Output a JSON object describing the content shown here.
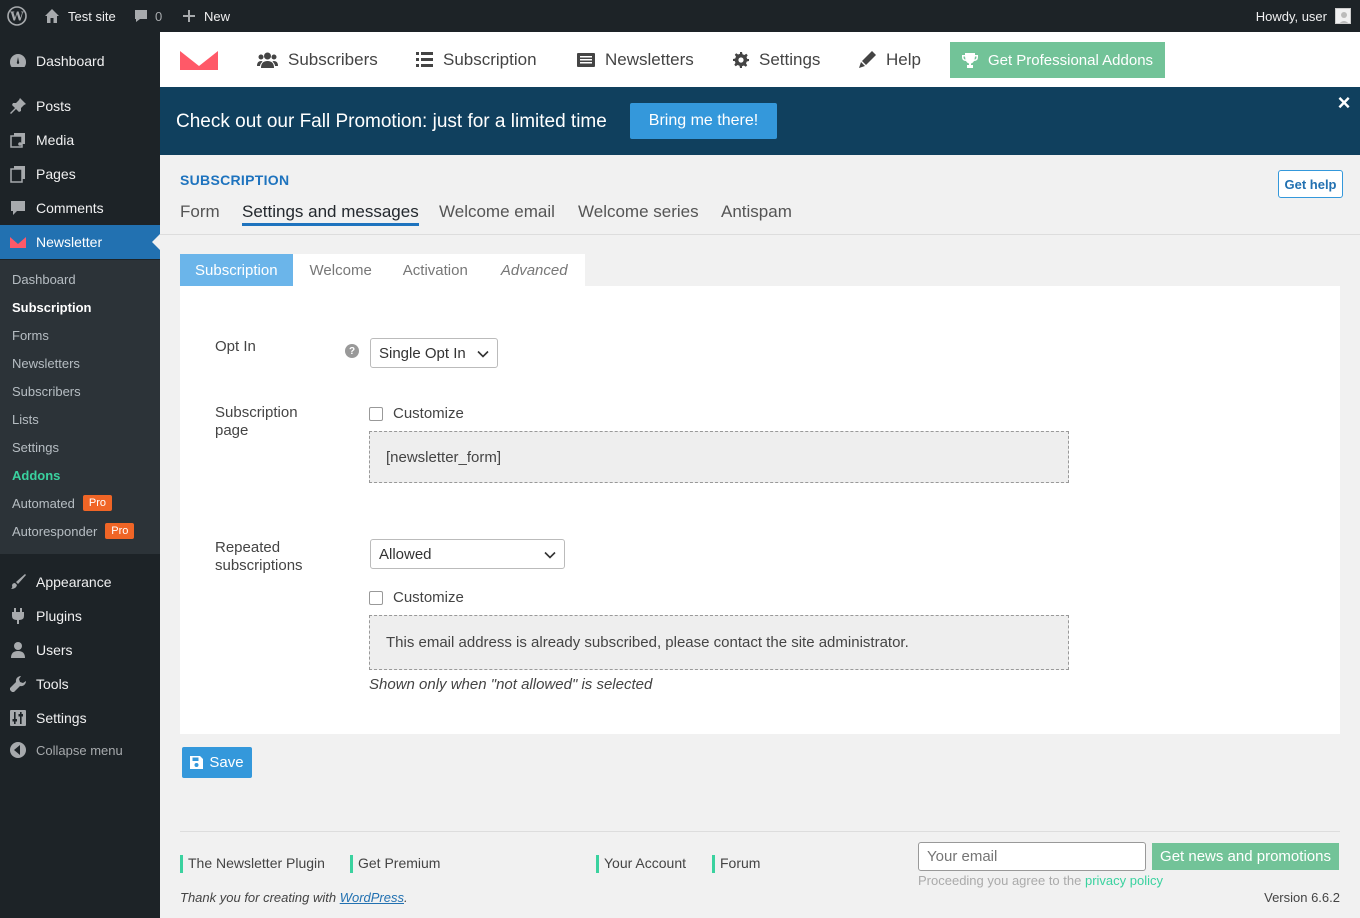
{
  "admin_bar": {
    "site_name": "Test site",
    "comments_count": "0",
    "new_label": "New",
    "howdy": "Howdy, user"
  },
  "sidebar": {
    "items": [
      {
        "label": "Dashboard",
        "icon": "dashboard-icon"
      },
      {
        "label": "Posts",
        "icon": "pin-icon"
      },
      {
        "label": "Media",
        "icon": "media-icon"
      },
      {
        "label": "Pages",
        "icon": "pages-icon"
      },
      {
        "label": "Comments",
        "icon": "comment-icon"
      },
      {
        "label": "Newsletter",
        "icon": "newsletter-icon"
      },
      {
        "label": "Appearance",
        "icon": "brush-icon"
      },
      {
        "label": "Plugins",
        "icon": "plug-icon"
      },
      {
        "label": "Users",
        "icon": "user-icon"
      },
      {
        "label": "Tools",
        "icon": "wrench-icon"
      },
      {
        "label": "Settings",
        "icon": "sliders-icon"
      }
    ],
    "submenu": [
      {
        "label": "Dashboard"
      },
      {
        "label": "Subscription"
      },
      {
        "label": "Forms"
      },
      {
        "label": "Newsletters"
      },
      {
        "label": "Subscribers"
      },
      {
        "label": "Lists"
      },
      {
        "label": "Settings"
      },
      {
        "label": "Addons"
      },
      {
        "label": "Automated",
        "badge": "Pro"
      },
      {
        "label": "Autoresponder",
        "badge": "Pro"
      }
    ],
    "collapse_label": "Collapse menu"
  },
  "topnav": {
    "items": [
      {
        "label": "Subscribers",
        "icon": "users-icon"
      },
      {
        "label": "Subscription",
        "icon": "list-icon"
      },
      {
        "label": "Newsletters",
        "icon": "newspaper-icon"
      },
      {
        "label": "Settings",
        "icon": "cog-icon"
      },
      {
        "label": "Help",
        "icon": "pen-icon"
      }
    ],
    "pro_addons": "Get Professional Addons"
  },
  "promo": {
    "text": "Check out our Fall Promotion: just for a limited time",
    "button": "Bring me there!",
    "close": "×"
  },
  "section": {
    "title": "SUBSCRIPTION",
    "help": "Get help",
    "tabs": [
      "Form",
      "Settings and messages",
      "Welcome email",
      "Welcome series",
      "Antispam"
    ]
  },
  "subtabs": [
    "Subscription",
    "Welcome",
    "Activation",
    "Advanced"
  ],
  "form": {
    "optin_label": "Opt In",
    "optin_value": "Single Opt In",
    "sub_page_label": "Subscription page",
    "customize": "Customize",
    "sub_page_value": "[newsletter_form]",
    "repeated_label": "Repeated subscriptions",
    "repeated_value": "Allowed",
    "repeated_message": "This email address is already subscribed, please contact the site administrator.",
    "repeated_note": "Shown only when \"not allowed\" is selected"
  },
  "save_label": "Save",
  "footer": {
    "links": [
      "The Newsletter Plugin",
      "Get Premium",
      "Your Account",
      "Forum"
    ],
    "email_placeholder": "Your email",
    "news_button": "Get news and promotions",
    "agree_text": "Proceeding you agree to the",
    "privacy": "privacy policy",
    "thanks_pre": "Thank you for creating with",
    "wordpress": "WordPress",
    "thanks_post": ".",
    "version": "Version 6.6.2"
  },
  "colors": {
    "accent": "#2271b1",
    "promo_bg": "#10405e",
    "button_blue": "#3498db",
    "green": "#72c398",
    "pro_orange": "#f06526"
  }
}
